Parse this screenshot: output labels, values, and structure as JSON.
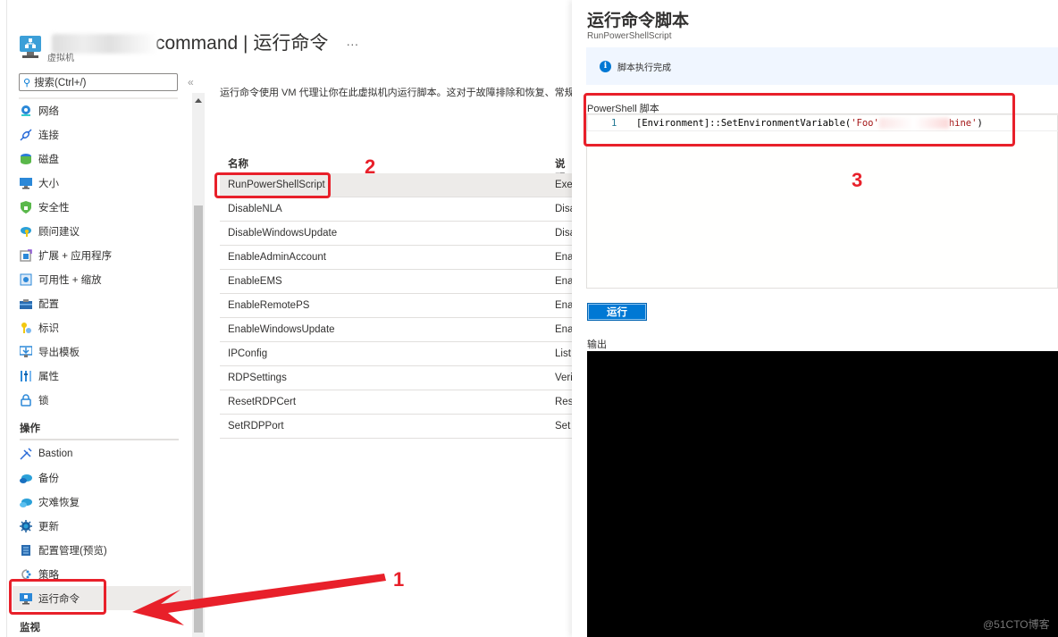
{
  "header": {
    "title_suffix": "command | 运行命令",
    "more": "···",
    "subtitle": "虚拟机"
  },
  "search": {
    "placeholder": "搜索(Ctrl+/)",
    "collapse": "«"
  },
  "sidebar": {
    "items": [
      {
        "label": "网络",
        "icon": "network-icon"
      },
      {
        "label": "连接",
        "icon": "connect-icon"
      },
      {
        "label": "磁盘",
        "icon": "disk-icon"
      },
      {
        "label": "大小",
        "icon": "size-icon"
      },
      {
        "label": "安全性",
        "icon": "security-icon"
      },
      {
        "label": "顾问建议",
        "icon": "advisor-icon"
      },
      {
        "label": "扩展 + 应用程序",
        "icon": "extensions-icon"
      },
      {
        "label": "可用性 + 缩放",
        "icon": "availability-icon"
      },
      {
        "label": "配置",
        "icon": "configuration-icon"
      },
      {
        "label": "标识",
        "icon": "identity-icon"
      },
      {
        "label": "导出模板",
        "icon": "export-template-icon"
      },
      {
        "label": "属性",
        "icon": "properties-icon"
      },
      {
        "label": "锁",
        "icon": "lock-icon"
      }
    ],
    "section_operations": "操作",
    "operations": [
      {
        "label": "Bastion",
        "icon": "bastion-icon"
      },
      {
        "label": "备份",
        "icon": "backup-icon"
      },
      {
        "label": "灾难恢复",
        "icon": "disaster-recovery-icon"
      },
      {
        "label": "更新",
        "icon": "updates-icon"
      },
      {
        "label": "配置管理(预览)",
        "icon": "config-management-icon"
      },
      {
        "label": "策略",
        "icon": "policy-icon"
      },
      {
        "label": "运行命令",
        "icon": "run-command-icon",
        "active": true
      }
    ],
    "section_monitoring": "监视"
  },
  "main": {
    "description": "运行命令使用 VM 代理让你在此虚拟机内运行脚本。这对于故障排除和恢复、常规",
    "table": {
      "headers": [
        "名称",
        "说明"
      ],
      "rows": [
        {
          "name": "RunPowerShellScript",
          "desc": "Exec",
          "selected": true
        },
        {
          "name": "DisableNLA",
          "desc": "Disa"
        },
        {
          "name": "DisableWindowsUpdate",
          "desc": "Disa"
        },
        {
          "name": "EnableAdminAccount",
          "desc": "Enal"
        },
        {
          "name": "EnableEMS",
          "desc": "Enal"
        },
        {
          "name": "EnableRemotePS",
          "desc": "Enal"
        },
        {
          "name": "EnableWindowsUpdate",
          "desc": "Enal"
        },
        {
          "name": "IPConfig",
          "desc": "List"
        },
        {
          "name": "RDPSettings",
          "desc": "Veri"
        },
        {
          "name": "ResetRDPCert",
          "desc": "Rest"
        },
        {
          "name": "SetRDPPort",
          "desc": "Set"
        }
      ]
    }
  },
  "panel": {
    "title": "运行命令脚本",
    "subtitle": "RunPowerShellScript",
    "info_message": "脚本执行完成",
    "script_label": "PowerShell 脚本",
    "code_line_number": "1",
    "code_prefix": "[Environment]::SetEnvironmentVariable(",
    "code_str1": "'Foo'",
    "code_str2": "hine'",
    "code_suffix": ")",
    "run_button": "运行",
    "output_label": "输出"
  },
  "annotations": {
    "n1": "1",
    "n2": "2",
    "n3": "3",
    "color": "#e8202a"
  },
  "watermark": "@51CTO博客"
}
